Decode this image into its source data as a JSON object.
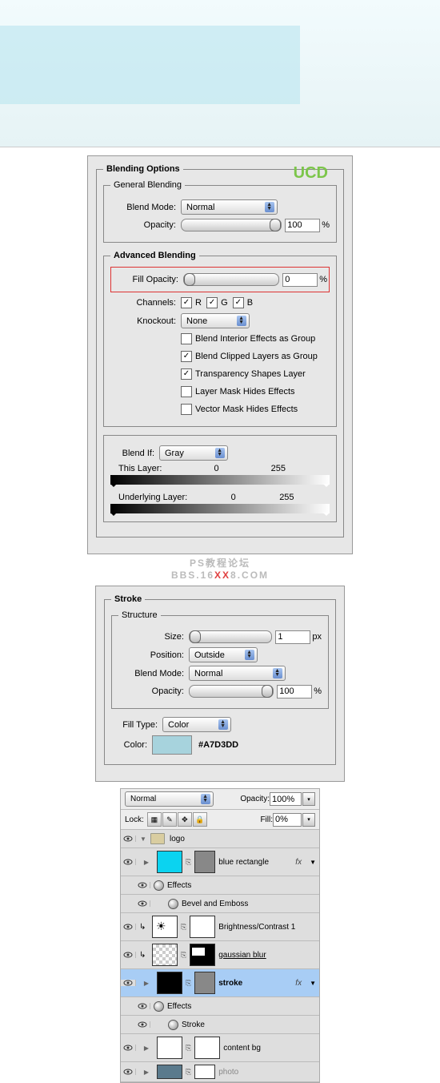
{
  "hero": {},
  "blending": {
    "title": "Blending Options",
    "general": {
      "legend": "General Blending",
      "blend_mode_label": "Blend Mode:",
      "blend_mode_value": "Normal",
      "opacity_label": "Opacity:",
      "opacity_value": "100",
      "opacity_unit": "%"
    },
    "advanced": {
      "legend": "Advanced Blending",
      "fill_opacity_label": "Fill Opacity:",
      "fill_opacity_value": "0",
      "fill_opacity_unit": "%",
      "channels_label": "Channels:",
      "channel_r": "R",
      "channel_g": "G",
      "channel_b": "B",
      "knockout_label": "Knockout:",
      "knockout_value": "None",
      "opt_interior": "Blend Interior Effects as Group",
      "opt_clipped": "Blend Clipped Layers as Group",
      "opt_transparency": "Transparency Shapes Layer",
      "opt_layermask": "Layer Mask Hides Effects",
      "opt_vectormask": "Vector Mask Hides Effects"
    },
    "blendif": {
      "label": "Blend If:",
      "value": "Gray",
      "this_layer": "This Layer:",
      "this_min": "0",
      "this_max": "255",
      "under_layer": "Underlying Layer:",
      "under_min": "0",
      "under_max": "255"
    },
    "watermark": "UCD"
  },
  "watermark2": {
    "pre": "PS教程论坛",
    "text": "BBS.16",
    "xx": "XX",
    "suffix": "8.COM"
  },
  "stroke": {
    "title": "Stroke",
    "structure": {
      "legend": "Structure",
      "size_label": "Size:",
      "size_value": "1",
      "size_unit": "px",
      "position_label": "Position:",
      "position_value": "Outside",
      "blend_mode_label": "Blend Mode:",
      "blend_mode_value": "Normal",
      "opacity_label": "Opacity:",
      "opacity_value": "100",
      "opacity_unit": "%"
    },
    "fill_type_label": "Fill Type:",
    "fill_type_value": "Color",
    "color_label": "Color:",
    "color_hex": "#A7D3DD"
  },
  "layers": {
    "mode": "Normal",
    "opacity_label": "Opacity:",
    "opacity_value": "100%",
    "lock_label": "Lock:",
    "fill_label": "Fill:",
    "fill_value": "0%",
    "items": {
      "logo": "logo",
      "blue_rect": "blue rectangle",
      "effects": "Effects",
      "bevel": "Bevel and Emboss",
      "brightness": "Brightness/Contrast 1",
      "gaussian": "gaussian blur",
      "stroke_layer": "stroke",
      "stroke_fx": "Stroke",
      "content_bg": "content bg",
      "photo": "photo"
    },
    "fx": "fx"
  }
}
